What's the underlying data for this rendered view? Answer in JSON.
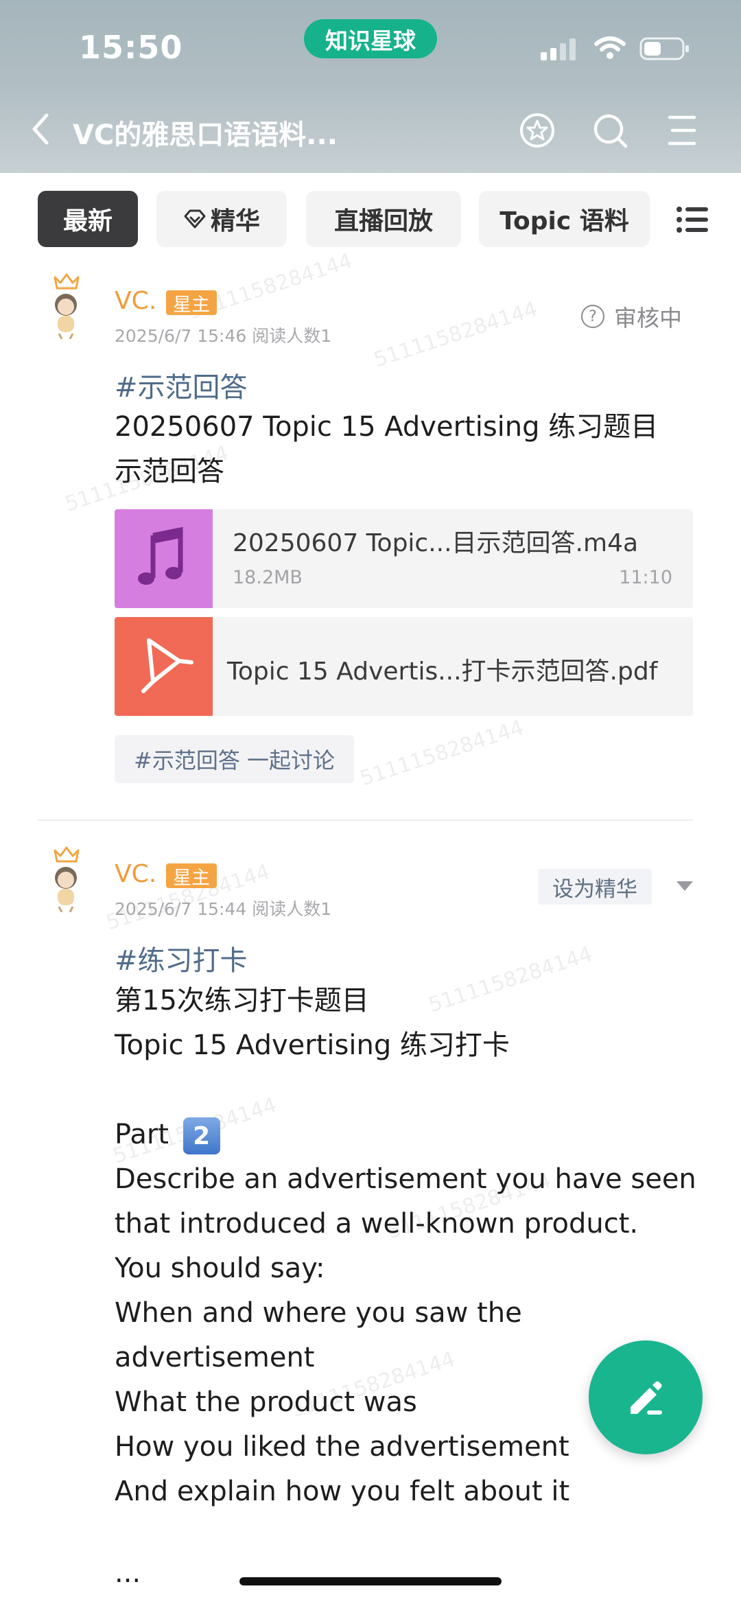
{
  "status_bar": {
    "time": "15:50",
    "app_pill": "知识星球"
  },
  "nav": {
    "title": "VC的雅思口语语料..."
  },
  "tabs": [
    {
      "label": "最新"
    },
    {
      "label": "精华"
    },
    {
      "label": "直播回放"
    },
    {
      "label": "Topic 语料"
    }
  ],
  "posts": [
    {
      "author": "VC.",
      "badge": "星主",
      "meta": "2025/6/7 15:46   阅读人数1",
      "status": "审核中",
      "hashtag": "#示范回答",
      "lines": [
        "20250607 Topic  15 Advertising 练习题目",
        "示范回答"
      ],
      "files": [
        {
          "name": "20250607 Topic...目示范回答.m4a",
          "size": "18.2MB",
          "duration": "11:10"
        },
        {
          "name": "Topic 15 Advertis...打卡示范回答.pdf"
        }
      ],
      "tag_chip": "#示范回答 一起讨论"
    },
    {
      "author": "VC.",
      "badge": "星主",
      "meta": "2025/6/7 15:44   阅读人数1",
      "action": "设为精华",
      "hashtag": "#练习打卡",
      "lines": [
        "第15次练习打卡题目",
        "Topic 15 Advertising 练习打卡",
        "",
        "Part",
        "Describe an advertisement you have seen",
        "that introduced a well-known product.",
        "You should say:",
        "When and where you saw the",
        "advertisement",
        "What the product was",
        "How you liked the advertisement",
        "And explain how you felt about it",
        "",
        "..."
      ],
      "part_number": "2"
    }
  ],
  "watermark": "5111158284144",
  "colors": {
    "accent": "#16b28c",
    "owner": "#f19a3a",
    "hashtag": "#4f6b89",
    "audio": "#d67ee0",
    "pdf": "#f16a55"
  }
}
